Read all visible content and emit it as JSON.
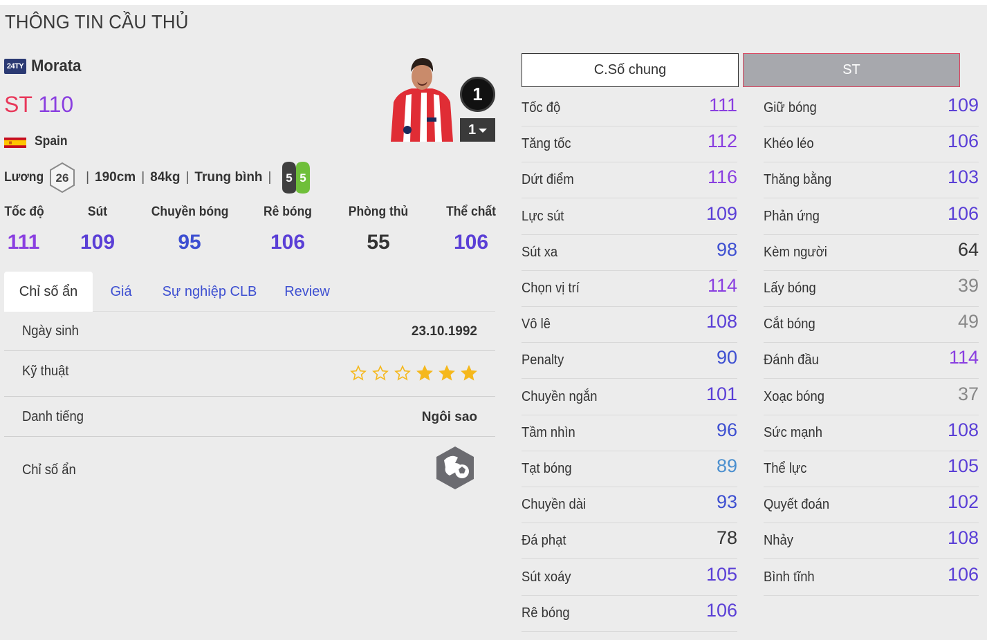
{
  "page_title": "THÔNG TIN CẦU THỦ",
  "player": {
    "season_badge": "24TY",
    "name": "Morata",
    "position": "ST",
    "overall": "110",
    "nation": "Spain",
    "upgrade_level": "1",
    "level_select": "1",
    "salary_label": "Lương",
    "salary": "26",
    "height": "190cm",
    "weight": "84kg",
    "body_type": "Trung bình",
    "weak_foot": "5",
    "strong_foot": "5",
    "sep": "|"
  },
  "main_stats": [
    {
      "label": "Tốc độ",
      "value": "111",
      "color": "#8a3fe0"
    },
    {
      "label": "Sút",
      "value": "109",
      "color": "#5a3fd6"
    },
    {
      "label": "Chuyền bóng",
      "value": "95",
      "color": "#3d4fd1"
    },
    {
      "label": "Rê bóng",
      "value": "106",
      "color": "#5a3fd6"
    },
    {
      "label": "Phòng thủ",
      "value": "55",
      "color": "#333333"
    },
    {
      "label": "Thể chất",
      "value": "106",
      "color": "#5a3fd6"
    }
  ],
  "tabs": [
    "Chỉ số ẩn",
    "Giá",
    "Sự nghiệp CLB",
    "Review"
  ],
  "details": {
    "birth_label": "Ngày sinh",
    "birth_value": "23.10.1992",
    "skill_label": "Kỹ thuật",
    "skill_stars_filled": 3,
    "skill_stars_total": 6,
    "reputation_label": "Danh tiếng",
    "reputation_value": "Ngôi sao",
    "hidden_label": "Chỉ số ẩn"
  },
  "stat_tabs": {
    "general": "C.Số chung",
    "position": "ST"
  },
  "stats_left": [
    {
      "label": "Tốc độ",
      "value": "111",
      "color": "#8a3fe0"
    },
    {
      "label": "Tăng tốc",
      "value": "112",
      "color": "#8a3fe0"
    },
    {
      "label": "Dứt điểm",
      "value": "116",
      "color": "#8a3fe0"
    },
    {
      "label": "Lực sút",
      "value": "109",
      "color": "#5a3fd6"
    },
    {
      "label": "Sút xa",
      "value": "98",
      "color": "#3d4fd1"
    },
    {
      "label": "Chọn vị trí",
      "value": "114",
      "color": "#8a3fe0"
    },
    {
      "label": "Vô lê",
      "value": "108",
      "color": "#5a3fd6"
    },
    {
      "label": "Penalty",
      "value": "90",
      "color": "#3d4fd1"
    },
    {
      "label": "Chuyền ngắn",
      "value": "101",
      "color": "#5a3fd6"
    },
    {
      "label": "Tầm nhìn",
      "value": "96",
      "color": "#3d4fd1"
    },
    {
      "label": "Tạt bóng",
      "value": "89",
      "color": "#4a8fcf"
    },
    {
      "label": "Chuyền dài",
      "value": "93",
      "color": "#3d4fd1"
    },
    {
      "label": "Đá phạt",
      "value": "78",
      "color": "#333333"
    },
    {
      "label": "Sút xoáy",
      "value": "105",
      "color": "#5a3fd6"
    },
    {
      "label": "Rê bóng",
      "value": "106",
      "color": "#5a3fd6"
    }
  ],
  "stats_right": [
    {
      "label": "Giữ bóng",
      "value": "109",
      "color": "#5a3fd6"
    },
    {
      "label": "Khéo léo",
      "value": "106",
      "color": "#5a3fd6"
    },
    {
      "label": "Thăng bằng",
      "value": "103",
      "color": "#5a3fd6"
    },
    {
      "label": "Phản ứng",
      "value": "106",
      "color": "#5a3fd6"
    },
    {
      "label": "Kèm người",
      "value": "64",
      "color": "#333333"
    },
    {
      "label": "Lấy bóng",
      "value": "39",
      "color": "#888888"
    },
    {
      "label": "Cắt bóng",
      "value": "49",
      "color": "#888888"
    },
    {
      "label": "Đánh đầu",
      "value": "114",
      "color": "#8a3fe0"
    },
    {
      "label": "Xoạc bóng",
      "value": "37",
      "color": "#888888"
    },
    {
      "label": "Sức mạnh",
      "value": "108",
      "color": "#5a3fd6"
    },
    {
      "label": "Thể lực",
      "value": "105",
      "color": "#5a3fd6"
    },
    {
      "label": "Quyết đoán",
      "value": "102",
      "color": "#5a3fd6"
    },
    {
      "label": "Nhảy",
      "value": "108",
      "color": "#5a3fd6"
    },
    {
      "label": "Bình tĩnh",
      "value": "106",
      "color": "#5a3fd6"
    }
  ]
}
